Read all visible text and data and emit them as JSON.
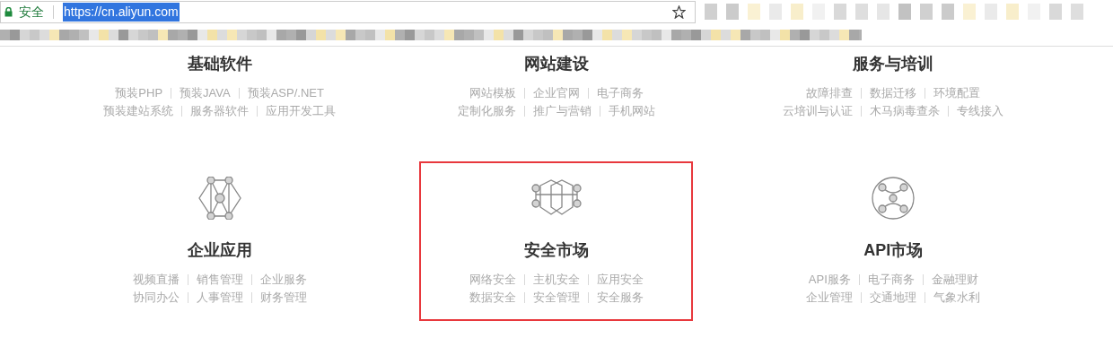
{
  "browser": {
    "security_label": "安全",
    "url": "https://cn.aliyun.com",
    "url_selected": true
  },
  "sections": [
    {
      "title": "基础软件",
      "highlighted": false,
      "links": [
        [
          "预装PHP",
          "预装JAVA",
          "预装ASP/.NET"
        ],
        [
          "预装建站系统",
          "服务器软件",
          "应用开发工具"
        ]
      ]
    },
    {
      "title": "网站建设",
      "highlighted": false,
      "links": [
        [
          "网站模板",
          "企业官网",
          "电子商务"
        ],
        [
          "定制化服务",
          "推广与营销",
          "手机网站"
        ]
      ]
    },
    {
      "title": "服务与培训",
      "highlighted": false,
      "links": [
        [
          "故障排查",
          "数据迁移",
          "环境配置"
        ],
        [
          "云培训与认证",
          "木马病毒查杀",
          "专线接入"
        ]
      ]
    },
    {
      "title": "企业应用",
      "kind": "hexagon-network",
      "highlighted": false,
      "links": [
        [
          "视频直播",
          "销售管理",
          "企业服务"
        ],
        [
          "协同办公",
          "人事管理",
          "财务管理"
        ]
      ]
    },
    {
      "title": "安全市场",
      "kind": "double-hexagon",
      "highlighted": true,
      "links": [
        [
          "网络安全",
          "主机安全",
          "应用安全"
        ],
        [
          "数据安全",
          "安全管理",
          "安全服务"
        ]
      ]
    },
    {
      "title": "API市场",
      "kind": "circle-network",
      "highlighted": false,
      "links": [
        [
          "API服务",
          "电子商务",
          "金融理财"
        ],
        [
          "企业管理",
          "交通地理",
          "气象水利"
        ]
      ]
    }
  ]
}
